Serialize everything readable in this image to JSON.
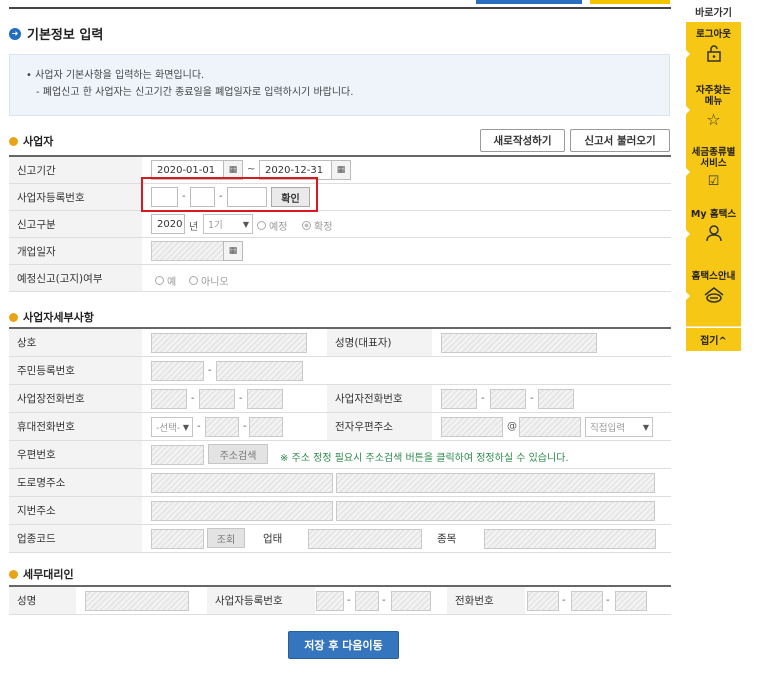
{
  "page_title": "기본정보 입력",
  "notice": {
    "line1": "• 사업자 기본사항을 입력하는 화면입니다.",
    "line2": "- 폐업신고 한 사업자는 신고기간 종료일을 폐업일자로 입력하시기 바랍니다."
  },
  "business": {
    "section_title": "사업자",
    "new_button": "새로작성하기",
    "load_button": "신고서 불러오기",
    "labels": {
      "period": "신고기간",
      "regno": "사업자등록번호",
      "report_type": "신고구분",
      "open_date": "개업일자",
      "prenotice": "예정신고(고지)여부"
    },
    "period_start": "2020-01-01",
    "period_sep": "~",
    "period_end": "2020-12-31",
    "confirm_button": "확인",
    "year": "2020",
    "year_unit": "년",
    "half_select": "1기",
    "radio_preliminary": "예정",
    "radio_final": "확정",
    "radio_yes": "예",
    "radio_no": "아니오"
  },
  "detail": {
    "section_title": "사업자세부사항",
    "labels": {
      "trade_name": "상호",
      "rep_name": "성명(대표자)",
      "resident_no": "주민등록번호",
      "biz_phone": "사업장전화번호",
      "biz_tel": "사업자전화번호",
      "mobile": "휴대전화번호",
      "email": "전자우편주소",
      "postal": "우편번호",
      "road_addr": "도로명주소",
      "lot_addr": "지번주소",
      "industry_code": "업종코드",
      "business_type": "업태",
      "item": "종목"
    },
    "mobile_select": "-선택-",
    "email_at": "@",
    "email_select": "직접입력",
    "addr_search_button": "주소검색",
    "addr_note": "※ 주소 정정 필요시 주소검색 버튼을 클릭하여 정정하실 수 있습니다.",
    "lookup_button": "조회"
  },
  "agent": {
    "section_title": "세무대리인",
    "labels": {
      "name": "성명",
      "regno": "사업자등록번호",
      "phone": "전화번호"
    }
  },
  "save_button": "저장 후 다음이동",
  "sidebar": {
    "title": "바로가기",
    "items": [
      {
        "label": "로그아웃",
        "icon": "lock-icon"
      },
      {
        "label": "자주찾는 메뉴",
        "icon": "star-icon"
      },
      {
        "label": "세금종류별 서비스",
        "icon": "checkbox-icon"
      },
      {
        "label": "My 홈택스",
        "icon": "person-icon"
      },
      {
        "label": "홈택스안내",
        "icon": "house-icon"
      }
    ],
    "fold": "접기^"
  }
}
